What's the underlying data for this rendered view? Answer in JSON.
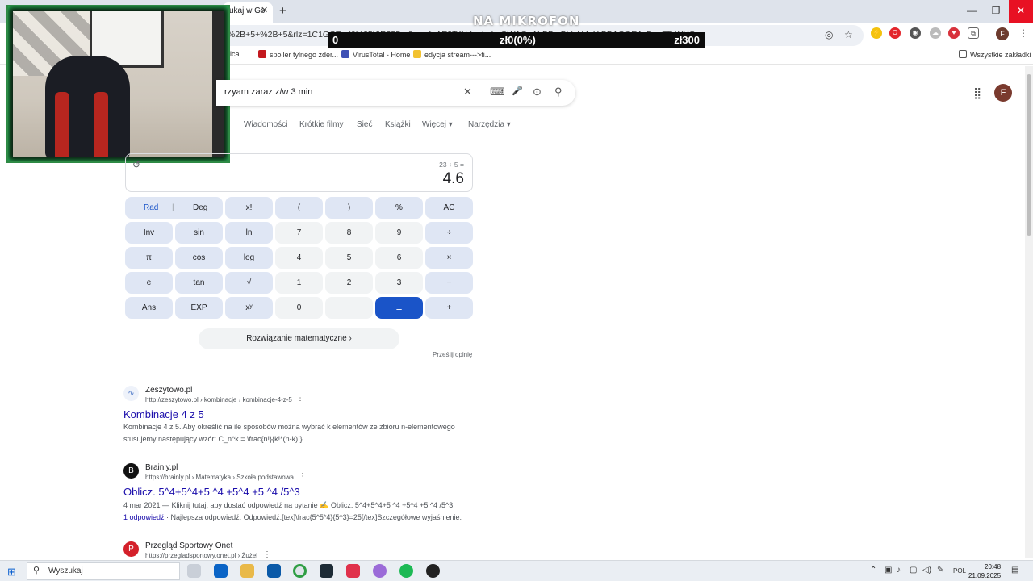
{
  "browser": {
    "tab_title": "ukaj w Go",
    "url": "%2B+5+%2B+5&rlz=1C1GCE...(0%25)2R255...&sxsrf=AE3TifNdrmhpbnQWAQgAhBB...BhhAMgYIBBAGGEAyBggFEAYYQ...",
    "window_buttons": {
      "minimize": "—",
      "restore": "❐",
      "close": "✕"
    },
    "toolbar_icons": [
      "eye-off-icon",
      "star-icon"
    ],
    "profile_letter": "F",
    "bookmarks": [
      {
        "label": "nica...",
        "color": "#c44"
      },
      {
        "label": "spoiler tylnego zder...",
        "color": "#c3181e"
      },
      {
        "label": "VirusTotal - Home",
        "color": "#3f51b5"
      },
      {
        "label": "edycja stream--->ti...",
        "color": "#f2c230"
      }
    ],
    "all_bookmarks": "Wszystkie zakładki"
  },
  "overlay": {
    "title": "NA MIKROFON",
    "donation_left": "0",
    "donation_mid": "zł0(0%)",
    "donation_right": "zł300"
  },
  "search": {
    "query": "rzyam zaraz z/w 3 min",
    "clear": "✕",
    "keyboard": "⌨",
    "mic": "🎤",
    "lens": "⊙",
    "submit": "⚲",
    "account_letter": "F",
    "apps": "⋮⋮⋮"
  },
  "nav_tabs": [
    "Wiadomości",
    "Krótkie filmy",
    "Sieć",
    "Książki",
    "Więcej ▾",
    "Narzędzia ▾"
  ],
  "calculator": {
    "history_icon": "↺",
    "expression": "23 ÷ 5 =",
    "result": "4.6",
    "rad": "Rad",
    "deg": "Deg",
    "keys": [
      [
        "x!",
        "(",
        ")",
        "%",
        "AC"
      ],
      [
        "Inv",
        "sin",
        "ln",
        "7",
        "8",
        "9",
        "÷"
      ],
      [
        "π",
        "cos",
        "log",
        "4",
        "5",
        "6",
        "×"
      ],
      [
        "e",
        "tan",
        "√",
        "1",
        "2",
        "3",
        "−"
      ],
      [
        "Ans",
        "EXP",
        "xʸ",
        "0",
        ".",
        "=",
        "+"
      ]
    ],
    "solution_button": "Rozwiązanie matematyczne  ›",
    "feedback": "Prześlij opinię"
  },
  "results": [
    {
      "site": "Zeszytowo.pl",
      "crumb": "http://zeszytowo.pl › kombinacje › kombinacje-4-z-5",
      "title": "Kombinacje 4 z 5",
      "snippet1": "Kombinacje 4 z 5. Aby określić na ile sposobów można wybrać k elementów ze zbioru n-elementowego",
      "snippet2": "stusujemy następujący wzór: C_n^k = \\frac{n!}{k!*(n-k)!}",
      "favicon": "∿",
      "favicon_color": "#4a76c7"
    },
    {
      "site": "Brainly.pl",
      "crumb": "https://brainly.pl › Matematyka › Szkoła podstawowa",
      "title": "Oblicz. 5^4+5^4+5 ^4 +5^4 +5 ^4 /5^3",
      "snippet1": "4 mar 2021 — Kliknij tutaj, aby dostać odpowiedź na pytanie ✍ Oblicz. 5^4+5^4+5 ^4 +5^4 +5 ^4 /5^3",
      "snippet2_link": "1 odpowiedź",
      "snippet2": " · Najlepsza odpowiedź: Odpowiedź:[tex]\\frac{5^5*4}{5^3}=25[/tex]Szczegółowe wyjaśnienie:",
      "favicon": "B",
      "favicon_color": "#111"
    },
    {
      "site": "Przegląd Sportowy Onet",
      "crumb": "https://przegladsportowy.onet.pl › Żużel",
      "favicon": "P",
      "favicon_color": "#d4202a"
    }
  ],
  "taskbar": {
    "search_placeholder": "Wyszukaj",
    "language": "POL",
    "time": "20:48",
    "date": "21.09.2025"
  }
}
